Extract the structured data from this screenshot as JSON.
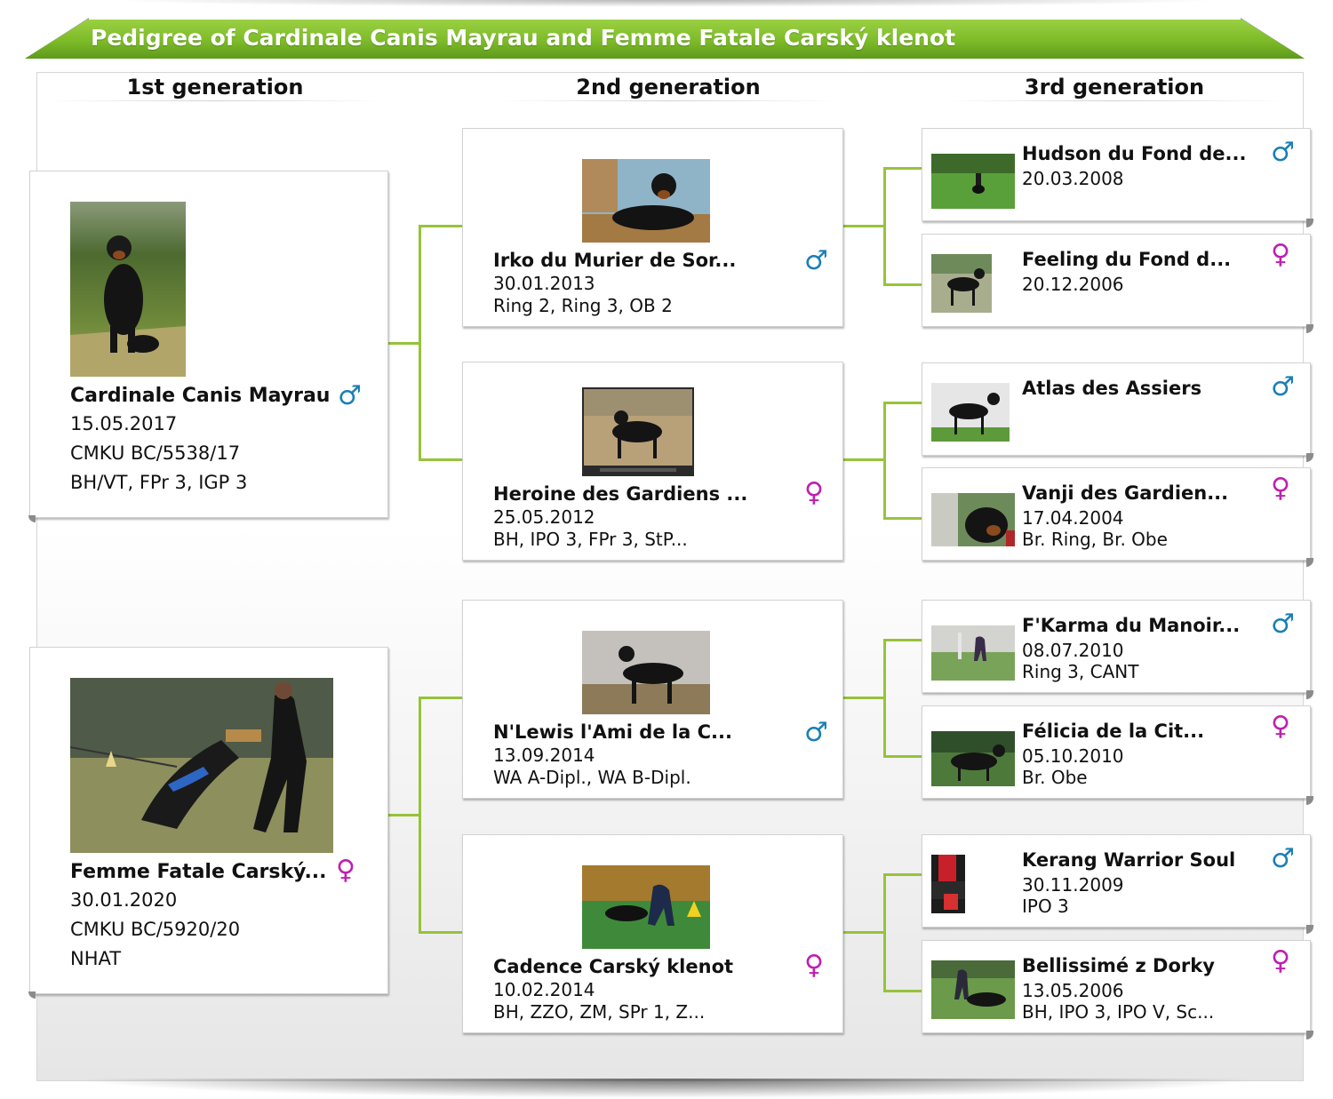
{
  "title": "Pedigree of Cardinale Canis Mayrau and Femme Fatale Carský klenot",
  "generations": [
    "1st generation",
    "2nd generation",
    "3rd generation"
  ],
  "colors": {
    "accent_green": "#7dbb28",
    "connector": "#96c33a",
    "male": "#1a7fb5",
    "female": "#bf1fb0"
  },
  "symbols": {
    "male": "♂",
    "female": "♀"
  },
  "gen1": [
    {
      "name": "Cardinale Canis Mayrau",
      "sex": "male",
      "date": "15.05.2017",
      "reg": "CMKU BC/5538/17",
      "titles": "BH/VT, FPr 3, IGP 3"
    },
    {
      "name": "Femme Fatale Carský...",
      "sex": "female",
      "date": "30.01.2020",
      "reg": "CMKU BC/5920/20",
      "titles": "NHAT"
    }
  ],
  "gen2": [
    {
      "name": "Irko du Murier de Sor...",
      "sex": "male",
      "date": "30.01.2013",
      "titles": "Ring 2, Ring 3, OB 2"
    },
    {
      "name": "Heroine des Gardiens ...",
      "sex": "female",
      "date": "25.05.2012",
      "titles": "BH, IPO 3, FPr 3, StP..."
    },
    {
      "name": "N'Lewis l'Ami de la C...",
      "sex": "male",
      "date": "13.09.2014",
      "titles": "WA A-Dipl., WA B-Dipl."
    },
    {
      "name": "Cadence Carský klenot",
      "sex": "female",
      "date": "10.02.2014",
      "titles": "BH, ZZO, ZM, SPr 1, Z..."
    }
  ],
  "gen3": [
    {
      "name": "Hudson du Fond de...",
      "sex": "male",
      "date": "20.03.2008",
      "titles": ""
    },
    {
      "name": "Feeling du Fond d...",
      "sex": "female",
      "date": "20.12.2006",
      "titles": ""
    },
    {
      "name": "Atlas des Assiers",
      "sex": "male",
      "date": "",
      "titles": ""
    },
    {
      "name": "Vanji des Gardien...",
      "sex": "female",
      "date": "17.04.2004",
      "titles": "Br. Ring, Br. Obe"
    },
    {
      "name": "F'Karma du Manoir...",
      "sex": "male",
      "date": "08.07.2010",
      "titles": "Ring 3, CANT"
    },
    {
      "name": "Félicia de la Cit...",
      "sex": "female",
      "date": "05.10.2010",
      "titles": "Br. Obe"
    },
    {
      "name": "Kerang Warrior Soul",
      "sex": "male",
      "date": "30.11.2009",
      "titles": "IPO 3"
    },
    {
      "name": "Bellissimé z Dorky",
      "sex": "female",
      "date": "13.05.2006",
      "titles": "BH, IPO 3, IPO V, Sc..."
    }
  ]
}
